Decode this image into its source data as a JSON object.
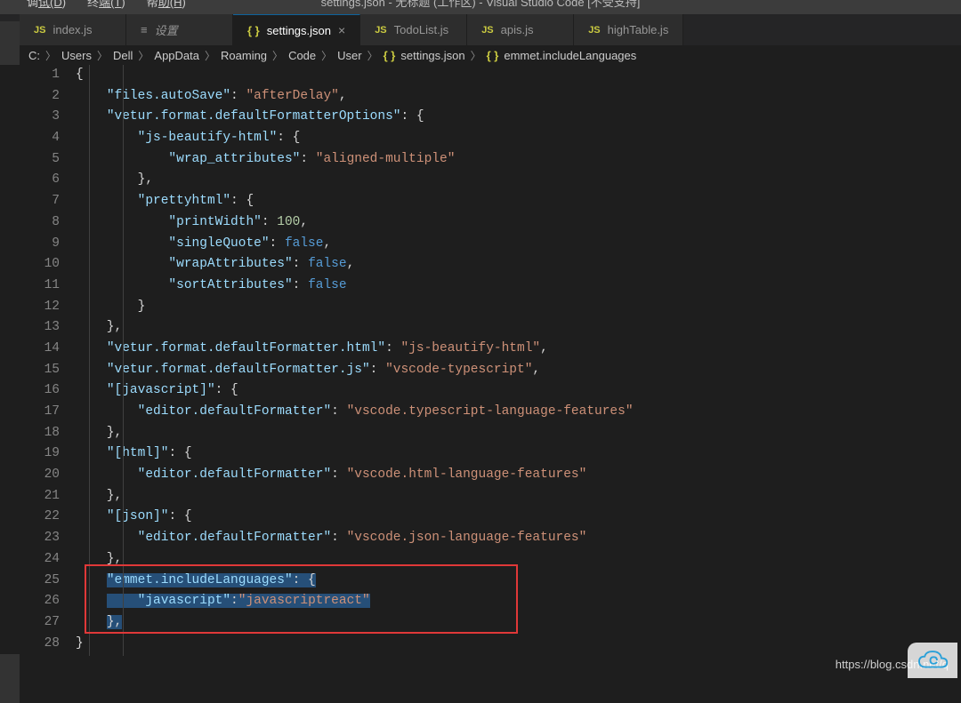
{
  "menu": {
    "debug": "调试(D)",
    "terminal": "终端(T)",
    "help": "帮助(H)"
  },
  "window_title": "settings.json - 无标题 (工作区) - Visual Studio Code [不受支持]",
  "tabs": [
    {
      "icon": "js",
      "label": "index.js"
    },
    {
      "icon": "settings",
      "label": "设置"
    },
    {
      "icon": "braces",
      "label": "settings.json",
      "active": true,
      "closeable": true
    },
    {
      "icon": "js",
      "label": "TodoList.js"
    },
    {
      "icon": "js",
      "label": "apis.js"
    },
    {
      "icon": "js",
      "label": "highTable.js"
    }
  ],
  "breadcrumbs": [
    "C:",
    "Users",
    "Dell",
    "AppData",
    "Roaming",
    "Code",
    "User",
    "settings.json",
    "emmet.includeLanguages"
  ],
  "code_content": {
    "1": "{",
    "2": {
      "k": "files.autoSave",
      "v": "afterDelay"
    },
    "3": {
      "k": "vetur.format.defaultFormatterOptions"
    },
    "4": {
      "k": "js-beautify-html"
    },
    "5": {
      "k": "wrap_attributes",
      "v": "aligned-multiple"
    },
    "7": {
      "k": "prettyhtml"
    },
    "8": {
      "k": "printWidth",
      "n": "100"
    },
    "9": {
      "k": "singleQuote",
      "b": "false"
    },
    "10": {
      "k": "wrapAttributes",
      "b": "false"
    },
    "11": {
      "k": "sortAttributes",
      "b": "false"
    },
    "14": {
      "k": "vetur.format.defaultFormatter.html",
      "v": "js-beautify-html"
    },
    "15": {
      "k": "vetur.format.defaultFormatter.js",
      "v": "vscode-typescript"
    },
    "16": {
      "k": "[javascript]"
    },
    "17": {
      "k": "editor.defaultFormatter",
      "v": "vscode.typescript-language-features"
    },
    "19": {
      "k": "[html]"
    },
    "20": {
      "k": "editor.defaultFormatter",
      "v": "vscode.html-language-features"
    },
    "22": {
      "k": "[json]"
    },
    "23": {
      "k": "editor.defaultFormatter",
      "v": "vscode.json-language-features"
    },
    "25": {
      "k": "emmet.includeLanguages"
    },
    "26": {
      "k": "javascript",
      "v": "javascriptreact"
    }
  },
  "watermark": "https://blog.csdn.net/q"
}
